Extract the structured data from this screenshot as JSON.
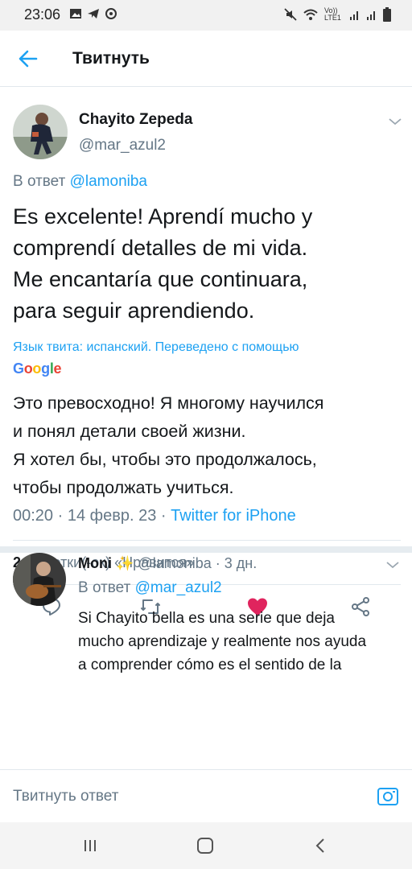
{
  "status_bar": {
    "time": "23:06",
    "network_label": "Vo)) LTE1",
    "icons": [
      "image-icon",
      "telegram-icon",
      "notification-icon",
      "mute-icon",
      "wifi-icon",
      "signal-icon",
      "signal-icon",
      "battery-icon"
    ]
  },
  "header": {
    "back_icon": "arrow-left-icon",
    "title": "Твитнуть"
  },
  "tweet": {
    "author_name": "Chayito Zepeda",
    "author_handle": "@mar_azul2",
    "reply_prefix": "В ответ",
    "reply_mention": "@lamoniba",
    "text": "Es excelente! Aprendí mucho y\ncomprendí detalles de mi vida.\nMe encantaría que continuara,\npara seguir aprendiendo.",
    "translation_note": "Язык твита: испанский. Переведено с помощью",
    "translation_provider": "Google",
    "translated_text": "Это превосходно! Я многому научился\nи понял детали своей жизни.\nЯ хотел бы, чтобы это продолжалось,\nчтобы продолжать учиться.",
    "time": "00:20",
    "date": "14 февр. 23",
    "source": "Twitter for iPhone",
    "like_count": "2",
    "like_label": "Отметки(-ок) «Нравится»",
    "liked": true
  },
  "reply": {
    "author_name": "Moni",
    "author_emoji": "✨",
    "author_handle": "@lamoniba",
    "age": "3 дн.",
    "reply_prefix": "В ответ",
    "reply_mention": "@mar_azul2",
    "text": "Si Chayito bella es una serie que deja\nmucho aprendizaje y realmente nos ayuda\na comprender cómo es el sentido de la"
  },
  "compose": {
    "placeholder": "Твитнуть ответ"
  },
  "colors": {
    "accent": "#1da1f2",
    "like": "#e0245e",
    "secondary_text": "#657786"
  }
}
